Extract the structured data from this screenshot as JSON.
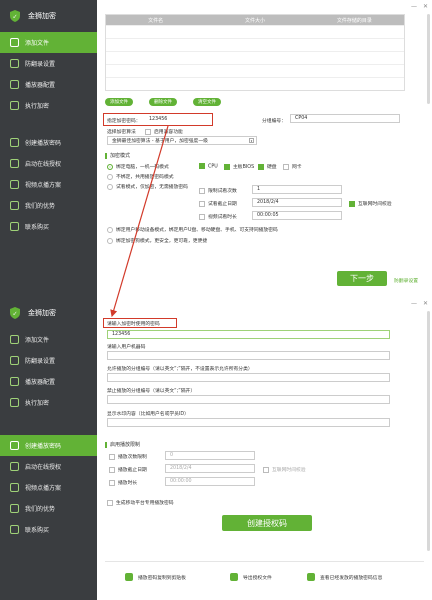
{
  "app": {
    "title": "金狮加密"
  },
  "window": {
    "minimize": "—",
    "close": "✕"
  },
  "sidebar1": {
    "items": [
      {
        "label": "添加文件",
        "active": true
      },
      {
        "label": "防翻录设置",
        "active": false
      },
      {
        "label": "播放器配置",
        "active": false
      },
      {
        "label": "执行加密",
        "active": false
      },
      {
        "label": "创建播放密码",
        "active": false
      },
      {
        "label": "启动在线授权",
        "active": false
      },
      {
        "label": "视频点播方案",
        "active": false
      },
      {
        "label": "我们的优势",
        "active": false
      },
      {
        "label": "联系购买",
        "active": false
      }
    ]
  },
  "sidebar2": {
    "items": [
      {
        "label": "添加文件",
        "active": false
      },
      {
        "label": "防翻录设置",
        "active": false
      },
      {
        "label": "播放器配置",
        "active": false
      },
      {
        "label": "执行加密",
        "active": false
      },
      {
        "label": "创建播放密码",
        "active": true
      },
      {
        "label": "启动在线授权",
        "active": false
      },
      {
        "label": "视频点播方案",
        "active": false
      },
      {
        "label": "我们的优势",
        "active": false
      },
      {
        "label": "联系购买",
        "active": false
      }
    ]
  },
  "table": {
    "headers": [
      "文件名",
      "文件大小",
      "文件存储的目录"
    ]
  },
  "toolbar": {
    "add": "添加文件",
    "remove": "删除文件",
    "clear": "清空文件"
  },
  "encrypt": {
    "password_label": "指定加密密码：",
    "password_value": "123456",
    "group_label": "分组编号：",
    "group_value": "CP04",
    "algo_label": "选择加密算法",
    "compat_label": "启用兼容功能",
    "algo_value": "金狮最佳加密算法 - 基于用户，加密强度一级"
  },
  "mode": {
    "section": "加密模式",
    "opt1": "绑定电脑，一机一码模式",
    "cpu": "CPU",
    "bios": "主板BIOS",
    "disk": "硬盘",
    "nic": "网卡",
    "opt2": "不绑定，共用播放密码模式",
    "opt3": "试看模式，仅加密，无需播放密码",
    "limit_count": "限制试看次数",
    "limit_count_value": "1",
    "trial_end": "试看截止日期",
    "trial_end_value": "2018/2/4",
    "net_time": "互联网时间校验",
    "video_dur": "视频试看时长",
    "video_dur_value": "00:00:05",
    "opt4": "绑定用户移动设备模式，绑定用户U盘、移动硬盘、手机、可支持同播放密码",
    "opt5": "绑定加密狗模式，更安全，更可靠，更便捷"
  },
  "next": {
    "label": "下一步",
    "link": "防翻录设置"
  },
  "p2": {
    "pwd_label": "请输入加密时使用的密码",
    "pwd_value": "123456",
    "machine_label": "请输入用户机器码",
    "allow_group_label": "允许播放的分组编号（请以英文“;”隔开，不设置表示允许所有分类）",
    "deny_group_label": "禁止播放的分组编号（请以英文“;”隔开）",
    "watermark_label": "显示水印内容（比如用户名或学员ID）",
    "limit_section": "启用播放限制",
    "limit_count": "播放次数限制",
    "limit_count_value": "0",
    "limit_date": "播放截止日期",
    "limit_date_value": "2018/2/4",
    "net_time": "互联网时间校验",
    "limit_dur": "播放时长",
    "limit_dur_value": "00:00:00",
    "platform": "生成移动平台专用播放密码",
    "create": "创建授权码",
    "foot1": "播放密码复制到剪贴板",
    "foot2": "导出授权文件",
    "foot3": "查看已经发放的播放密码信息"
  }
}
